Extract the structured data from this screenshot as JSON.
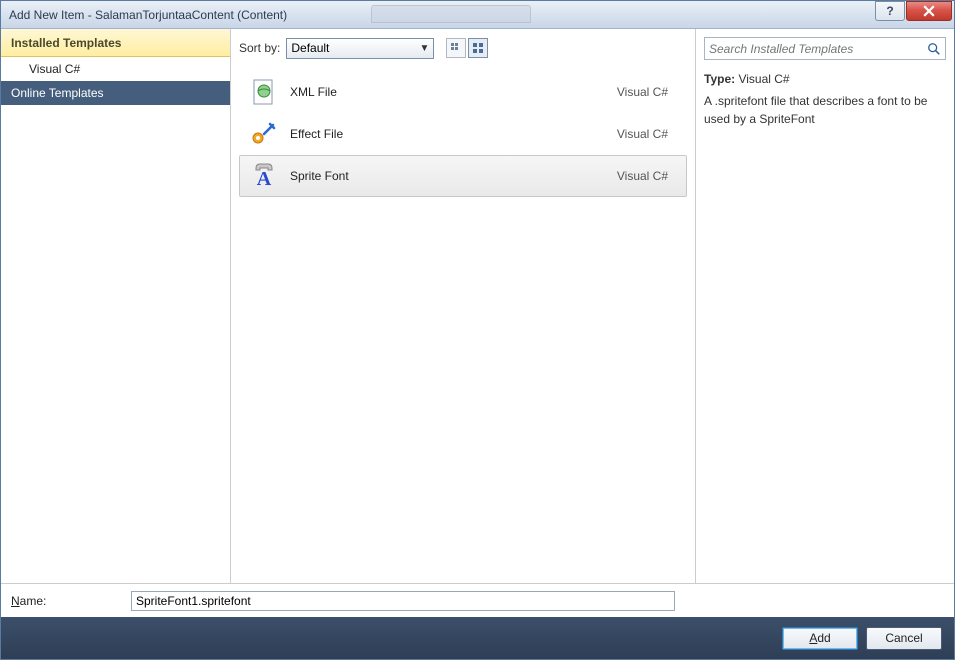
{
  "window": {
    "title": "Add New Item - SalamanTorjuntaaContent (Content)"
  },
  "sidebar": {
    "installed_header": "Installed Templates",
    "items": [
      {
        "label": "Visual C#"
      }
    ],
    "online_header": "Online Templates"
  },
  "toolbar": {
    "sortby_label": "Sort by:",
    "sortby_value": "Default"
  },
  "templates": [
    {
      "name": "XML File",
      "lang": "Visual C#",
      "icon": "xml",
      "selected": false
    },
    {
      "name": "Effect File",
      "lang": "Visual C#",
      "icon": "effect",
      "selected": false
    },
    {
      "name": "Sprite Font",
      "lang": "Visual C#",
      "icon": "spritefont",
      "selected": true
    }
  ],
  "search": {
    "placeholder": "Search Installed Templates"
  },
  "description": {
    "type_label": "Type:",
    "type_value": "Visual C#",
    "text": "A .spritefont file that describes a font to be used by a SpriteFont"
  },
  "name_field": {
    "label_pre": "N",
    "label_rest": "ame:",
    "value": "SpriteFont1.spritefont"
  },
  "buttons": {
    "add_pre": "A",
    "add_rest": "dd",
    "cancel": "Cancel"
  }
}
